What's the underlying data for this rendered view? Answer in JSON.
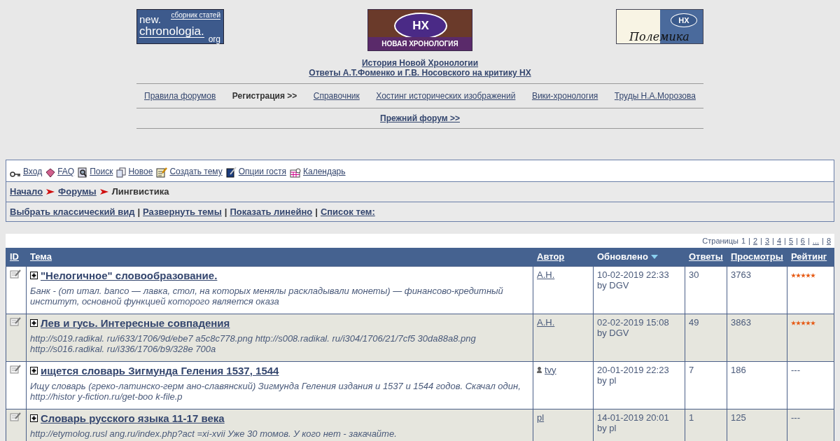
{
  "banner": {
    "left_logo": {
      "line1": "new.",
      "small": "сборник статей",
      "line2": "chronologia.",
      "line3": "org"
    },
    "center_logo": {
      "badge": "НХ",
      "caption": "НОВАЯ ХРОНОЛОГИЯ"
    },
    "right_logo": {
      "badge": "НХ",
      "word": "Полемика"
    }
  },
  "title_links": [
    "История Новой Хронологии",
    "Ответы А.Т.Фоменко и Г.В. Носовского на критику НХ"
  ],
  "nav": [
    {
      "label": "Правила форумов",
      "kind": "link"
    },
    {
      "label": "Регистрация >>",
      "kind": "bold"
    },
    {
      "label": "Справочник",
      "kind": "link"
    },
    {
      "label": "Хостинг исторических изображений",
      "kind": "link"
    },
    {
      "label": "Вики-хронология",
      "kind": "link"
    },
    {
      "label": "Труды Н.А.Морозова",
      "kind": "link"
    }
  ],
  "old_forum_link": "Прежний форум >>",
  "toolbar": [
    {
      "label": "Вход"
    },
    {
      "label": "FAQ"
    },
    {
      "label": "Поиск"
    },
    {
      "label": "Новое"
    },
    {
      "label": "Создать тему"
    },
    {
      "label": "Опции гостя"
    },
    {
      "label": "Календарь"
    }
  ],
  "breadcrumb": [
    {
      "label": "Начало",
      "kind": "link"
    },
    {
      "label": "Форумы",
      "kind": "link"
    },
    {
      "label": "Лингвистика",
      "kind": "current"
    }
  ],
  "view_links": [
    {
      "label": "Выбрать классический вид"
    },
    {
      "separator": "|",
      "label": "Развернуть темы"
    },
    {
      "separator": "|",
      "label": "Показать линейно"
    },
    {
      "separator": "|",
      "label": "Список тем:"
    }
  ],
  "pagination": {
    "label": "Страницы",
    "pages": [
      {
        "label": "1",
        "selected": true
      },
      {
        "separator": "|",
        "label": "2",
        "selected": false
      },
      {
        "separator": "|",
        "label": "3",
        "selected": false
      },
      {
        "separator": "|",
        "label": "4",
        "selected": false
      },
      {
        "separator": "|",
        "label": "5",
        "selected": false
      },
      {
        "separator": "|",
        "label": "6",
        "selected": false
      },
      {
        "separator": "|",
        "label": "...",
        "selected": false
      },
      {
        "separator": "|",
        "label": "8",
        "selected": false
      }
    ]
  },
  "table": {
    "columns": [
      {
        "label": "ID",
        "sorted": false
      },
      {
        "label": "Тема",
        "sorted": false
      },
      {
        "label": "Автор",
        "sorted": false
      },
      {
        "label": "Обновлено",
        "sorted": true
      },
      {
        "label": "Ответы",
        "sorted": false
      },
      {
        "label": "Просмотры",
        "sorted": false
      },
      {
        "label": "Рейтинг",
        "sorted": false
      }
    ],
    "rows": [
      {
        "title": "\"Нелогичное\" словообразование.",
        "excerpt": "Банк - (от итал. banco — лавка, стол, на которых менялы раскладывали монеты) — финансово-кредитный институт, основной функцией которого является оказа",
        "author": "А.Н.",
        "online": false,
        "updated": "10-02-2019 22:33",
        "updated_by": "by DGV",
        "replies": "30",
        "views": "3763",
        "stars": 5
      },
      {
        "title": "Лев и гусь. Интересные совпадения",
        "excerpt": "http://s019.radikal. ru/i633/1706/9d/ebe7 a5c8c778.png http://s008.radikal. ru/i304/1706/21/7cf5 30da88a8.png http://s016.radikal. ru/i336/1706/b9/328e 700a",
        "author": "А.Н.",
        "online": false,
        "updated": "02-02-2019 15:08",
        "updated_by": "by DGV",
        "replies": "49",
        "views": "3863",
        "stars": 5
      },
      {
        "title": "ищется словарь Зигмунда Геления 1537, 1544",
        "excerpt": "Ищу словарь (греко-латинско-герм ано-славянский) Зигмунда Геления издания и 1537 и 1544 годов. Скачал один, http://histor y-fiction.ru/get-boo k-file.p",
        "author": "tvy",
        "online": true,
        "updated": "20-01-2019 22:23",
        "updated_by": "by pl",
        "replies": "7",
        "views": "186",
        "rating": "---"
      },
      {
        "title": "Словарь русского языка 11-17 века",
        "excerpt": "http://etymolog.rusl ang.ru/index.php?act =xi-xvii Уже 30 томов. У кого нет - закачайте.",
        "author": "pl",
        "online": false,
        "updated": "14-01-2019 20:01",
        "updated_by": "by pl",
        "replies": "1",
        "views": "125",
        "rating": "---"
      }
    ]
  }
}
